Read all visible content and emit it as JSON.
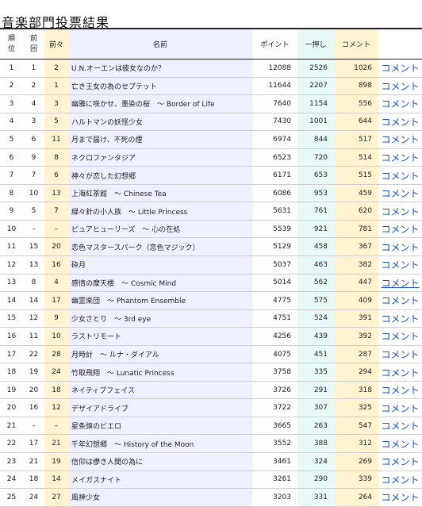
{
  "page_title": "音楽部門投票結果",
  "headers": {
    "rank": [
      "順",
      "位"
    ],
    "prev": [
      "前",
      "回"
    ],
    "prev2": "前々",
    "name": "名前",
    "points": "ポイント",
    "one_push": "一押し",
    "comments": "コメント",
    "link": ""
  },
  "rows": [
    {
      "rank": "1",
      "prev": "1",
      "prev2": "2",
      "name": "U.N.オーエンは彼女なのか？",
      "points": "12088",
      "one_push": "2526",
      "comments": "1026",
      "link": "コメント"
    },
    {
      "rank": "2",
      "prev": "2",
      "prev2": "1",
      "name": "亡き王女の為のセプテット",
      "points": "11644",
      "one_push": "2207",
      "comments": "898",
      "link": "コメント"
    },
    {
      "rank": "3",
      "prev": "4",
      "prev2": "3",
      "name": "幽雅に咲かせ、墨染の桜　～ Border of Life",
      "points": "7640",
      "one_push": "1154",
      "comments": "556",
      "link": "コメント"
    },
    {
      "rank": "4",
      "prev": "3",
      "prev2": "5",
      "name": "ハルトマンの妖怪少女",
      "points": "7430",
      "one_push": "1001",
      "comments": "644",
      "link": "コメント"
    },
    {
      "rank": "5",
      "prev": "6",
      "prev2": "11",
      "name": "月まで届け、不死の煙",
      "points": "6974",
      "one_push": "844",
      "comments": "517",
      "link": "コメント"
    },
    {
      "rank": "6",
      "prev": "9",
      "prev2": "8",
      "name": "ネクロファンタジア",
      "points": "6523",
      "one_push": "720",
      "comments": "514",
      "link": "コメント"
    },
    {
      "rank": "7",
      "prev": "7",
      "prev2": "6",
      "name": "神々が恋した幻想郷",
      "points": "6171",
      "one_push": "653",
      "comments": "515",
      "link": "コメント"
    },
    {
      "rank": "8",
      "prev": "10",
      "prev2": "13",
      "name": "上海紅茶館　～ Chinese Tea",
      "points": "6086",
      "one_push": "953",
      "comments": "459",
      "link": "コメント"
    },
    {
      "rank": "9",
      "prev": "5",
      "prev2": "7",
      "name": "緑々針の小人族　～ Little Princess",
      "points": "5631",
      "one_push": "761",
      "comments": "620",
      "link": "コメント"
    },
    {
      "rank": "10",
      "prev": "–",
      "prev2": "–",
      "name": "ピュアヒューリーズ　～ 心の在処",
      "points": "5539",
      "one_push": "921",
      "comments": "781",
      "link": "コメント"
    },
    {
      "rank": "11",
      "prev": "15",
      "prev2": "20",
      "name": "恋色マスタースパーク（恋色マジック）",
      "points": "5129",
      "one_push": "458",
      "comments": "367",
      "link": "コメント"
    },
    {
      "rank": "12",
      "prev": "13",
      "prev2": "16",
      "name": "砕月",
      "points": "5037",
      "one_push": "463",
      "comments": "382",
      "link": "コメント"
    },
    {
      "rank": "13",
      "prev": "8",
      "prev2": "4",
      "name": "感情の摩天楼　～ Cosmic Mind",
      "points": "5014",
      "one_push": "562",
      "comments": "447",
      "link": "コメント"
    },
    {
      "rank": "14",
      "prev": "14",
      "prev2": "17",
      "name": "幽霊楽団　～ Phantom Ensemble",
      "points": "4775",
      "one_push": "575",
      "comments": "409",
      "link": "コメント"
    },
    {
      "rank": "15",
      "prev": "12",
      "prev2": "9",
      "name": "少女さとり　～ 3rd eye",
      "points": "4751",
      "one_push": "524",
      "comments": "391",
      "link": "コメント"
    },
    {
      "rank": "16",
      "prev": "11",
      "prev2": "10",
      "name": "ラストリモート",
      "points": "4256",
      "one_push": "439",
      "comments": "392",
      "link": "コメント"
    },
    {
      "rank": "17",
      "prev": "22",
      "prev2": "28",
      "name": "月時計　～ ルナ・ダイアル",
      "points": "4075",
      "one_push": "451",
      "comments": "287",
      "link": "コメント"
    },
    {
      "rank": "18",
      "prev": "19",
      "prev2": "24",
      "name": "竹取飛翔　～ Lunatic Princess",
      "points": "3758",
      "one_push": "335",
      "comments": "294",
      "link": "コメント"
    },
    {
      "rank": "19",
      "prev": "20",
      "prev2": "18",
      "name": "ネイティブフェイス",
      "points": "3726",
      "one_push": "291",
      "comments": "318",
      "link": "コメント"
    },
    {
      "rank": "20",
      "prev": "16",
      "prev2": "12",
      "name": "デザイアドライブ",
      "points": "3722",
      "one_push": "307",
      "comments": "325",
      "link": "コメント"
    },
    {
      "rank": "21",
      "prev": "–",
      "prev2": "–",
      "name": "星条旗のピエロ",
      "points": "3665",
      "one_push": "263",
      "comments": "547",
      "link": "コメント"
    },
    {
      "rank": "22",
      "prev": "17",
      "prev2": "21",
      "name": "千年幻想郷　～ History of the Moon",
      "points": "3552",
      "one_push": "388",
      "comments": "312",
      "link": "コメント"
    },
    {
      "rank": "23",
      "prev": "21",
      "prev2": "19",
      "name": "信仰は儚き人間の為に",
      "points": "3461",
      "one_push": "324",
      "comments": "269",
      "link": "コメント"
    },
    {
      "rank": "24",
      "prev": "18",
      "prev2": "14",
      "name": "メイガスナイト",
      "points": "3261",
      "one_push": "290",
      "comments": "339",
      "link": "コメント"
    },
    {
      "rank": "25",
      "prev": "24",
      "prev2": "27",
      "name": "風神少女",
      "points": "3203",
      "one_push": "331",
      "comments": "264",
      "link": "コメント"
    }
  ],
  "hovered_link_row": 12,
  "colors": {
    "link": "#1a4fd8",
    "name_column_bg": "#eef0fe",
    "prev2_column_bg": "#fff4cf",
    "one_push_column_bg": "#e9f9f7",
    "comments_column_bg": "#fff4cf"
  }
}
